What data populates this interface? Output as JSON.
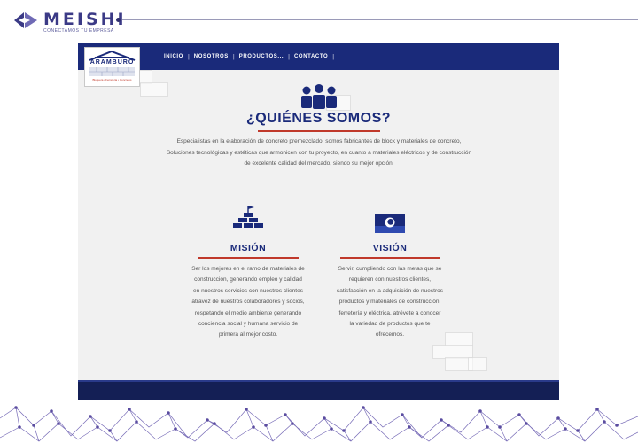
{
  "slide": {
    "brand_name": "MEISHI",
    "brand_tagline": "CONECTAMOS TU EMPRESA"
  },
  "site": {
    "logo": {
      "name": "ARAMBURO",
      "sub": "Bloquera • Ferreteria • Concretos"
    },
    "nav": [
      "INICIO",
      "NOSOTROS",
      "PRODUCTOS...",
      "CONTACTO"
    ],
    "about": {
      "icon": "people-group-icon",
      "title": "¿QUIÉNES SOMOS?",
      "text": "Especialistas en la elaboración de concreto premezclado, somos fabricantes de block y materiales de concreto, Soluciones tecnológicas y estéticas que armonicen con tu proyecto, en cuanto a materiales eléctricos y de construcción de excelente calidad del mercado, siendo su mejor opción."
    },
    "mission": {
      "icon": "brick-wall-flag-icon",
      "title": "MISIÓN",
      "text": "Ser los mejores en el ramo de materiales de construcción, generando empleo y calidad en nuestros servicios con nuestros clientes atravez de nuestros colaboradores y socios, respetando el medio ambiente generando conciencia social y humana servicio de primera al mejor costo."
    },
    "vision": {
      "icon": "eye-card-icon",
      "title": "VISIÓN",
      "text": "Servir, cumpliendo con las metas que se requieren con nuestros clientes, satisfacción en la adquisición de nuestros productos y materiales de construcción, ferretería y eléctrica, atrévete a conocer la variedad de productos que te ofrecemos."
    }
  },
  "colors": {
    "navy": "#1a2a7a",
    "accent_red": "#c0392b",
    "brand_purple": "#3b3a86",
    "network_purple": "#5a4ca0"
  }
}
